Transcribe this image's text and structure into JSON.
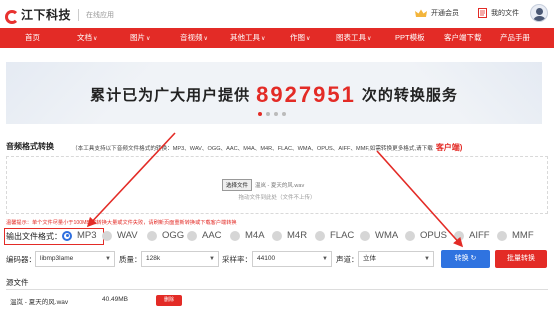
{
  "header": {
    "logo_text": "江下科技",
    "logo_sub": "在线应用",
    "vip_label": "开通会员",
    "my_files_label": "我的文件"
  },
  "nav": {
    "items": [
      {
        "label": "首页",
        "chevron": false
      },
      {
        "label": "文档",
        "chevron": true
      },
      {
        "label": "图片",
        "chevron": true
      },
      {
        "label": "音视频",
        "chevron": true
      },
      {
        "label": "其他工具",
        "chevron": true
      },
      {
        "label": "作图",
        "chevron": true
      },
      {
        "label": "图表工具",
        "chevron": true
      },
      {
        "label": "PPT模板",
        "chevron": false
      },
      {
        "label": "客户端下载",
        "chevron": false
      },
      {
        "label": "产品手册",
        "chevron": false
      }
    ],
    "chevron_glyph": "∨"
  },
  "banner": {
    "prefix": "累计已为广大用户提供",
    "number": "8927951",
    "suffix": "次的转换服务",
    "slides": 4,
    "active_slide": 1
  },
  "section": {
    "title": "音频格式转换",
    "description": "（本工具支持以下音频文件格式的转换：MP3、WAV、OGG、AAC、M4A、M4R、FLAC、WMA、OPUS、AIFF、MMF,如需转换更多格式,请下载",
    "client_link": "客户端)"
  },
  "upload": {
    "choose_button": "选择文件",
    "chosen_file": "温岚 - 夏天的风.wav",
    "hint": "拖动文件到此处（文件不上传）"
  },
  "warning": "温馨提示：单个文件尽量小于100MB,如转换大量或文件失败，请刷新页面重新转换或下载客户端转换",
  "format": {
    "label": "输出文件格式：",
    "options": [
      "MP3",
      "WAV",
      "OGG",
      "AAC",
      "M4A",
      "M4R",
      "FLAC",
      "WMA",
      "OPUS",
      "AIFF",
      "MMF"
    ],
    "selected": "MP3"
  },
  "params": {
    "encoder_label": "编码器：",
    "encoder_value": "libmp3lame",
    "quality_label": "质量：",
    "quality_value": "128k",
    "sample_label": "采样率：",
    "sample_value": "44100",
    "channel_label": "声道：",
    "channel_value": "立体",
    "convert_label": "转换",
    "batch_label": "批量转换"
  },
  "source": {
    "title": "源文件",
    "files": [
      {
        "name": "温岚 - 夏天的风.wav",
        "size": "40.49MB",
        "delete_label": "删除"
      }
    ]
  },
  "colors": {
    "brand_red": "#e32b26",
    "primary_blue": "#2f73e0"
  }
}
